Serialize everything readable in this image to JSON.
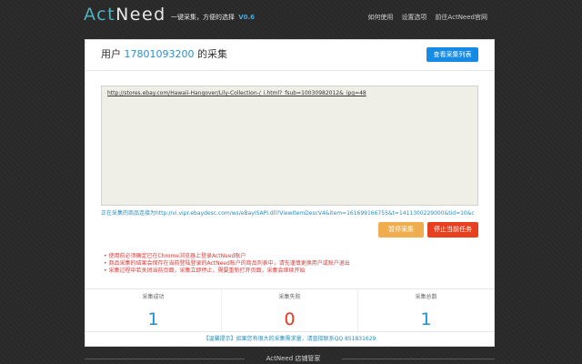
{
  "header": {
    "brand_part1": "Act",
    "brand_part2": "Need",
    "slogan": "一键采集，方便的选择",
    "version": "V0.6",
    "nav": [
      "如何使用",
      "设置选项",
      "前往ActNeed官网"
    ]
  },
  "panel": {
    "title_prefix": "用户",
    "user_phone": "17801093200",
    "title_suffix": "的采集",
    "view_list_button": "查看采集列表",
    "url_text": "http://stores.ebay.com/Hawaii-Hangover/Lily-Collection-/_i.html?_fsub=10030982012&_ipg=48",
    "current_page": "正在采集的商品连接为http://vi.vipr.ebaydesc.com/ws/eBayISAPI.dll?ViewItemDescV4&item=161699166755&t=1411300229000&tid=10&c",
    "pause_button": "暂停采集",
    "stop_button": "停止当前任务",
    "notes": [
      "使用前必须确定已在Chrome浏览器上登录ActNeed账户",
      "商品采集的结果会保存在当前登陆登录的ActNeed账户的商品列表中，请先谨慎更换用户或账户退出",
      "采集过程中若关闭当前页面，采集立即停止，需要重新打开页面，采集会继续开始"
    ],
    "stats": [
      {
        "label": "采集成功",
        "value": "1"
      },
      {
        "label": "采集失败",
        "value": "0"
      },
      {
        "label": "采集总数",
        "value": "1"
      }
    ],
    "tip": "【温馨提示】如果您有很大的采集需求量，请直接联系QQ 851831629"
  },
  "footer": {
    "text": "ActNeed 店铺管家"
  },
  "colors": {
    "accent_blue": "#168be6",
    "pause_orange": "#f0ad4e",
    "stop_red": "#e8401e",
    "success_blue": "#1f8fc9",
    "fail_red": "#e23a1e",
    "brand_teal": "#4fb0bf"
  }
}
